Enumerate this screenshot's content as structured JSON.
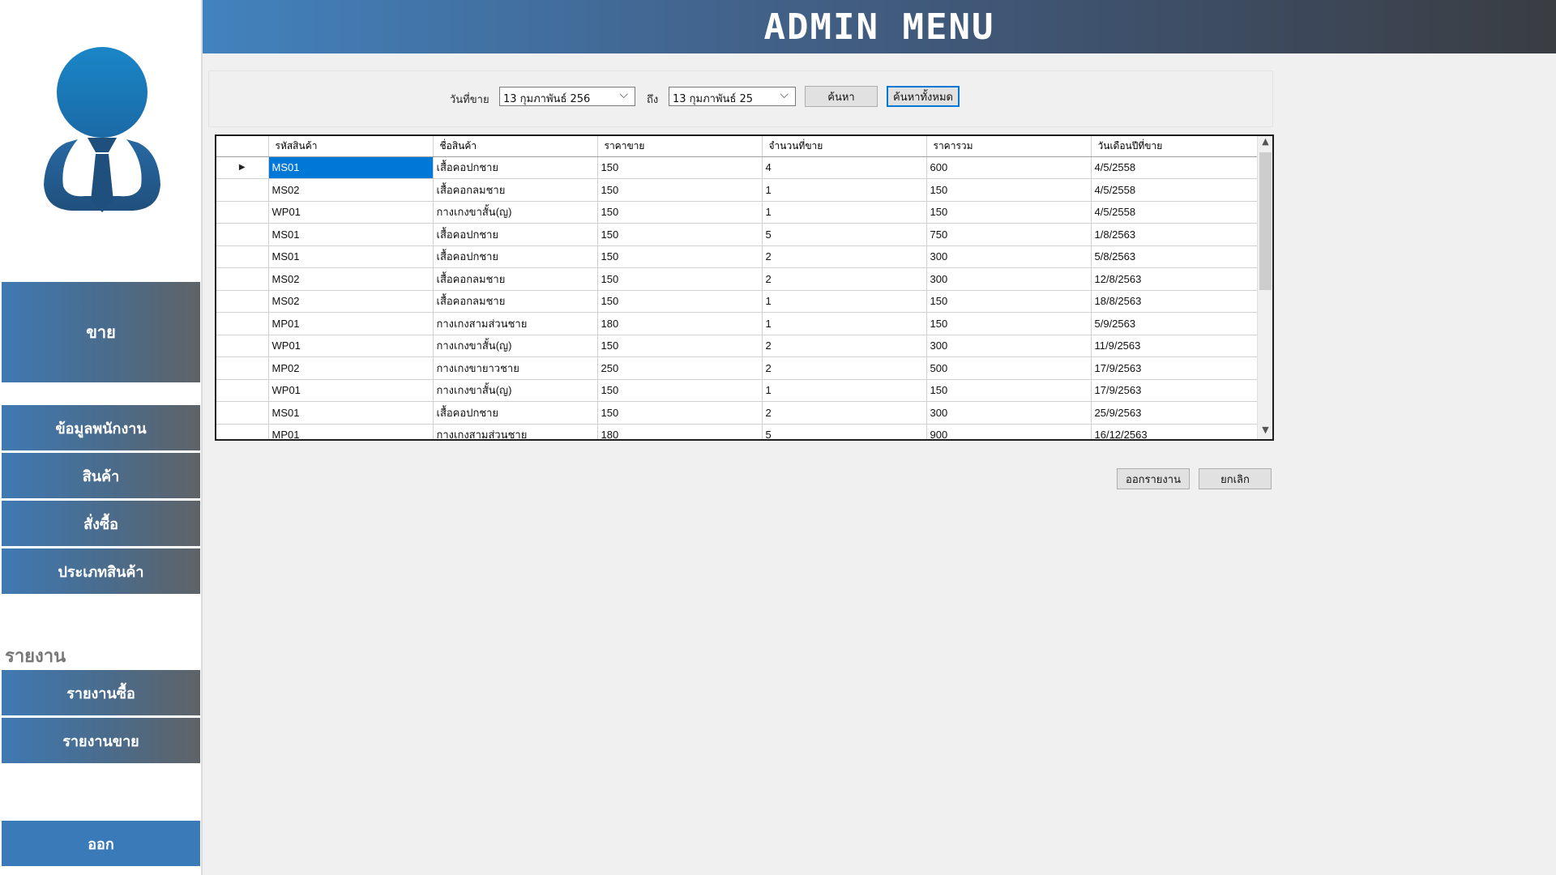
{
  "header": {
    "title": "ADMIN MENU"
  },
  "sidebar": {
    "sale": "ขาย",
    "employee": "ข้อมูลพนักงาน",
    "product": "สินค้า",
    "order": "สั่งซื้อ",
    "product_type": "ประเภทสินค้า",
    "report_section": "รายงาน",
    "report_buy": "รายงานซื้อ",
    "report_sell": "รายงานขาย",
    "exit": "ออก"
  },
  "filter": {
    "date_label": "วันที่ขาย",
    "from_date": "13  กุมภาพันธ์   256",
    "to_label": "ถึง",
    "to_date": "13  กุมภาพันธ์   25",
    "search_button": "ค้นหา",
    "search_all_button": "ค้นหาทั้งหมด"
  },
  "grid": {
    "columns": [
      "รหัสสินค้า",
      "ชื่อสินค้า",
      "ราคาขาย",
      "จำนวนที่ขาย",
      "ราคารวม",
      "วันเดือนปีที่ขาย"
    ],
    "rows": [
      [
        "MS01",
        "เสื้อคอปกชาย",
        "150",
        "4",
        "600",
        "4/5/2558"
      ],
      [
        "MS02",
        "เสื้อคอกลมชาย",
        "150",
        "1",
        "150",
        "4/5/2558"
      ],
      [
        "WP01",
        "กางเกงขาสั้น(ญ)",
        "150",
        "1",
        "150",
        "4/5/2558"
      ],
      [
        "MS01",
        "เสื้อคอปกชาย",
        "150",
        "5",
        "750",
        "1/8/2563"
      ],
      [
        "MS01",
        "เสื้อคอปกชาย",
        "150",
        "2",
        "300",
        "5/8/2563"
      ],
      [
        "MS02",
        "เสื้อคอกลมชาย",
        "150",
        "2",
        "300",
        "12/8/2563"
      ],
      [
        "MS02",
        "เสื้อคอกลมชาย",
        "150",
        "1",
        "150",
        "18/8/2563"
      ],
      [
        "MP01",
        "กางเกงสามส่วนชาย",
        "180",
        "1",
        "150",
        "5/9/2563"
      ],
      [
        "WP01",
        "กางเกงขาสั้น(ญ)",
        "150",
        "2",
        "300",
        "11/9/2563"
      ],
      [
        "MP02",
        "กางเกงขายาวชาย",
        "250",
        "2",
        "500",
        "17/9/2563"
      ],
      [
        "WP01",
        "กางเกงขาสั้น(ญ)",
        "150",
        "1",
        "150",
        "17/9/2563"
      ],
      [
        "MS01",
        "เสื้อคอปกชาย",
        "150",
        "2",
        "300",
        "25/9/2563"
      ],
      [
        "MP01",
        "กางเกงสามส่วนชาย",
        "180",
        "5",
        "900",
        "16/12/2563"
      ]
    ],
    "selected_row": 0
  },
  "actions": {
    "report_button": "ออกรายงาน",
    "cancel_button": "ยกเลิก"
  }
}
